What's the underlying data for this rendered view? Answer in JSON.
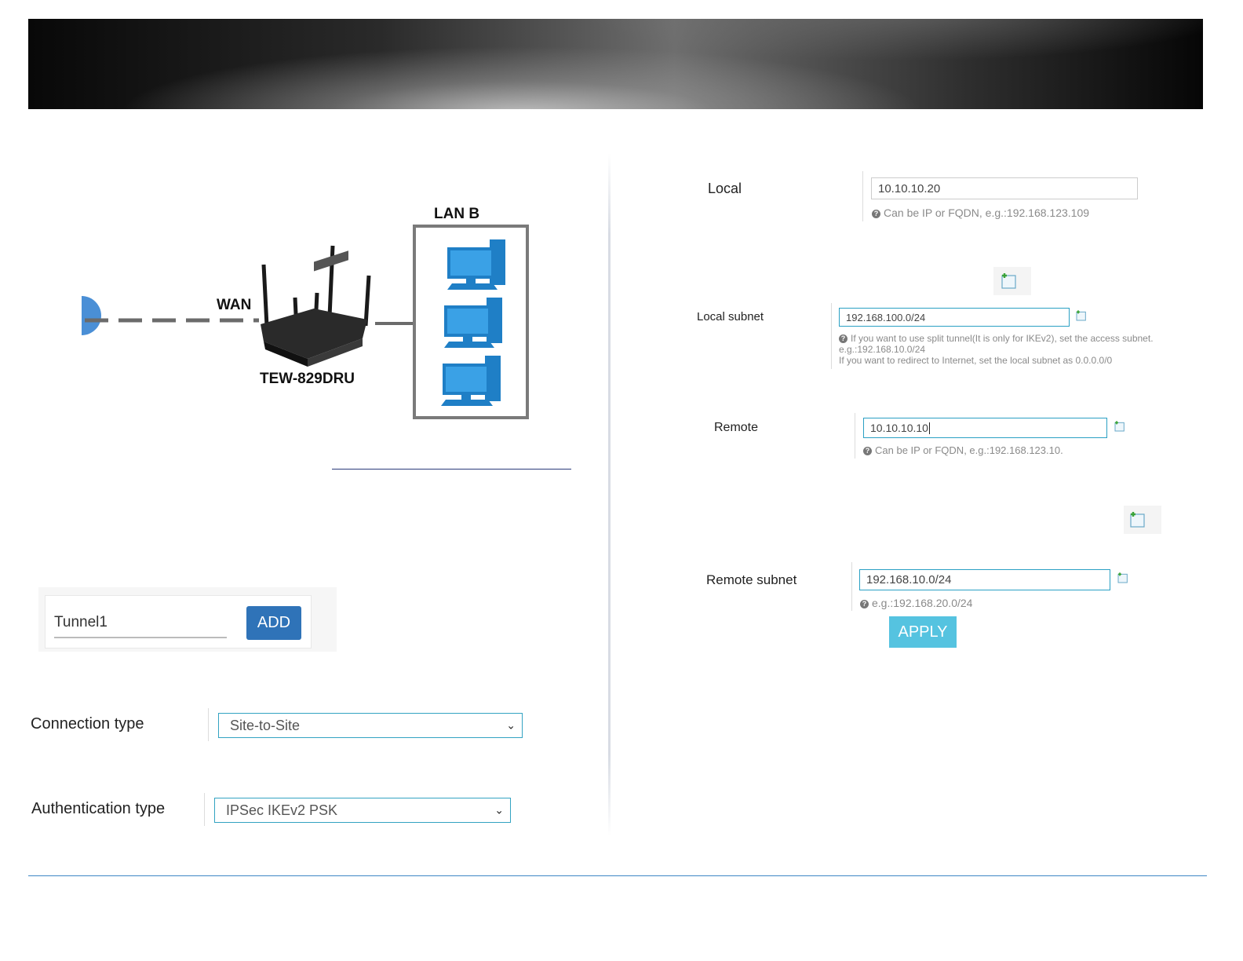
{
  "diagram": {
    "lan_label": "LAN B",
    "wan_label": "WAN",
    "router_label": "TEW-829DRU"
  },
  "tunnel": {
    "name_value": "Tunnel1",
    "add_label": "ADD"
  },
  "connection_type": {
    "label": "Connection type",
    "selected": "Site-to-Site"
  },
  "authentication_type": {
    "label": "Authentication type",
    "selected": "IPSec IKEv2 PSK"
  },
  "local": {
    "label": "Local",
    "value": "10.10.10.20",
    "hint": "Can be IP or FQDN, e.g.:192.168.123.109"
  },
  "local_subnet": {
    "label": "Local subnet",
    "value": "192.168.100.0/24",
    "hint_line1": "If you want to use split tunnel(It is only for IKEv2), set the access subnet.",
    "hint_line2": "e.g.:192.168.10.0/24",
    "hint_line3": "If you want to redirect to Internet, set the local subnet as 0.0.0.0/0"
  },
  "remote": {
    "label": "Remote",
    "value": "10.10.10.10",
    "hint": "Can be IP or FQDN, e.g.:192.168.123.10."
  },
  "remote_subnet": {
    "label": "Remote subnet",
    "value": "192.168.10.0/24",
    "hint": "e.g.:192.168.20.0/24"
  },
  "apply_label": "APPLY",
  "icons": {
    "add_row": "add-document-icon",
    "help": "question-circle-icon",
    "dropdown": "chevron-down-icon"
  },
  "colors": {
    "accent_blue": "#2f73b8",
    "apply_cyan": "#55c3e0",
    "focus_border": "#33a3c2",
    "footer_rule": "#3f86c6"
  }
}
